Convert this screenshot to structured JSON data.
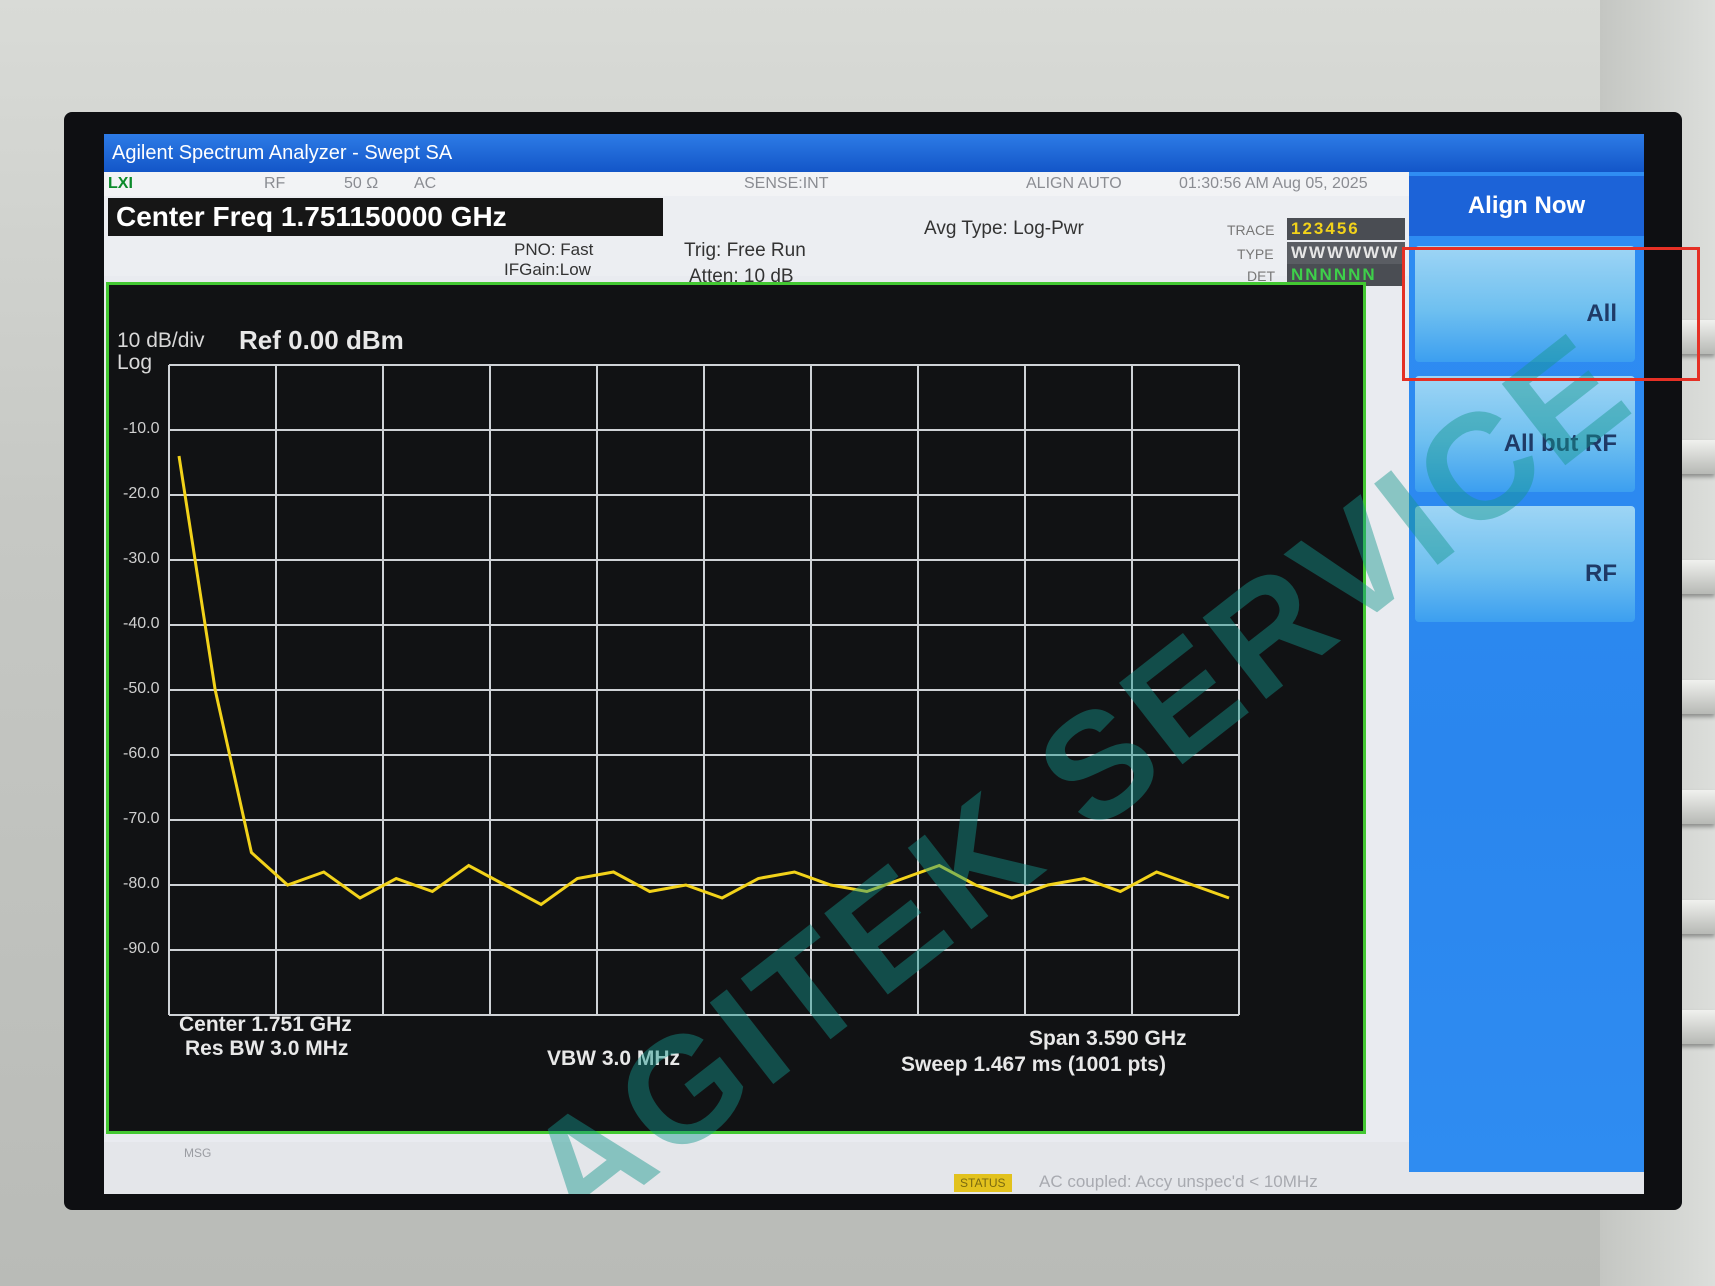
{
  "window": {
    "title": "Agilent Spectrum Analyzer - Swept SA"
  },
  "status_row": {
    "lxi": "LXI",
    "rf": "RF",
    "impedance": "50 Ω",
    "coupling": "AC",
    "sense": "SENSE:INT",
    "align": "ALIGN AUTO",
    "datetime": "01:30:56 AM Aug 05, 2025"
  },
  "measurement": {
    "center_freq_label": "Center Freq 1.751150000 GHz",
    "pno": "PNO: Fast",
    "ifgain": "IFGain:Low",
    "trig": "Trig: Free Run",
    "atten": "Atten: 10 dB",
    "avg_type": "Avg Type: Log-Pwr"
  },
  "trace_panel": {
    "trace_label": "TRACE",
    "type_label": "TYPE",
    "det_label": "DET",
    "trace_nums": "123456",
    "type_vals": "WWWWWW",
    "det_vals": "NNNNNN"
  },
  "plot": {
    "scale": "10 dB/div",
    "scale_type": "Log",
    "ref": "Ref 0.00 dBm",
    "y_labels": [
      "-10.0",
      "-20.0",
      "-30.0",
      "-40.0",
      "-50.0",
      "-60.0",
      "-70.0",
      "-80.0",
      "-90.0"
    ],
    "center": "Center 1.751 GHz",
    "res_bw": "Res BW 3.0 MHz",
    "vbw": "VBW 3.0 MHz",
    "span": "Span 3.590 GHz",
    "sweep": "Sweep  1.467 ms (1001 pts)",
    "trace_color": "#f2d21a",
    "grid_color": "#cfd2d6"
  },
  "chart_data": {
    "type": "line",
    "xlabel": "",
    "ylabel": "",
    "ylim": [
      -100,
      0
    ],
    "series": [
      {
        "values": [
          -14,
          -50,
          -75,
          -80,
          -78,
          -82,
          -79,
          -81,
          -77,
          -80,
          -83,
          -79,
          -78,
          -81,
          -80,
          -82,
          -79,
          -78,
          -80,
          -81,
          -79,
          -77,
          -80,
          -82,
          -80,
          -79,
          -81,
          -78,
          -80,
          -82
        ]
      }
    ]
  },
  "message_bar": {
    "msg": "MSG",
    "status_tag": "STATUS",
    "status_msg": "AC coupled: Accy unspec'd < 10MHz"
  },
  "softkeys": {
    "menu_title": "Align Now",
    "keys": [
      "All",
      "All but RF",
      "RF"
    ]
  },
  "watermark": "AGITEK SERVICE"
}
